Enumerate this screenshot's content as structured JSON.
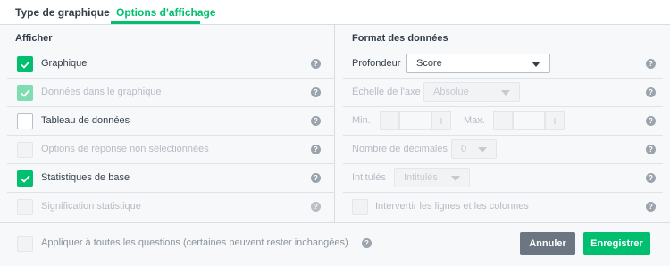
{
  "tabs": [
    {
      "label": "Type de graphique"
    },
    {
      "label": "Options d'affichage"
    }
  ],
  "left": {
    "title": "Afficher",
    "rows": [
      {
        "label": "Graphique",
        "checked": true
      },
      {
        "label": "Données dans le graphique",
        "checked": true,
        "disabled": true
      },
      {
        "label": "Tableau de données",
        "checked": false
      },
      {
        "label": "Options de réponse non sélectionnées",
        "checked": false,
        "disabled": true
      },
      {
        "label": "Statistiques de base",
        "checked": true
      },
      {
        "label": "Signification statistique",
        "checked": false,
        "disabled": true
      }
    ]
  },
  "right": {
    "title": "Format des données",
    "depth": {
      "label": "Profondeur",
      "value": "Score"
    },
    "axis_scale": {
      "label": "Échelle de l'axe",
      "value": "Absolue"
    },
    "minmax": {
      "min_label": "Min.",
      "max_label": "Max.",
      "minus": "−",
      "plus": "+"
    },
    "decimals": {
      "label": "Nombre de décimales",
      "value": "0"
    },
    "labels": {
      "label": "Intitulés",
      "value": "Intitulés"
    },
    "invert": {
      "label": "Intervertir les lignes et les colonnes"
    }
  },
  "apply_all": {
    "label": "Appliquer à toutes les questions (certaines peuvent rester inchangées)"
  },
  "buttons": {
    "cancel": "Annuler",
    "save": "Enregistrer"
  },
  "help_glyph": "?",
  "colors": {
    "accent": "#00bf6f",
    "cancel": "#6b7682"
  }
}
